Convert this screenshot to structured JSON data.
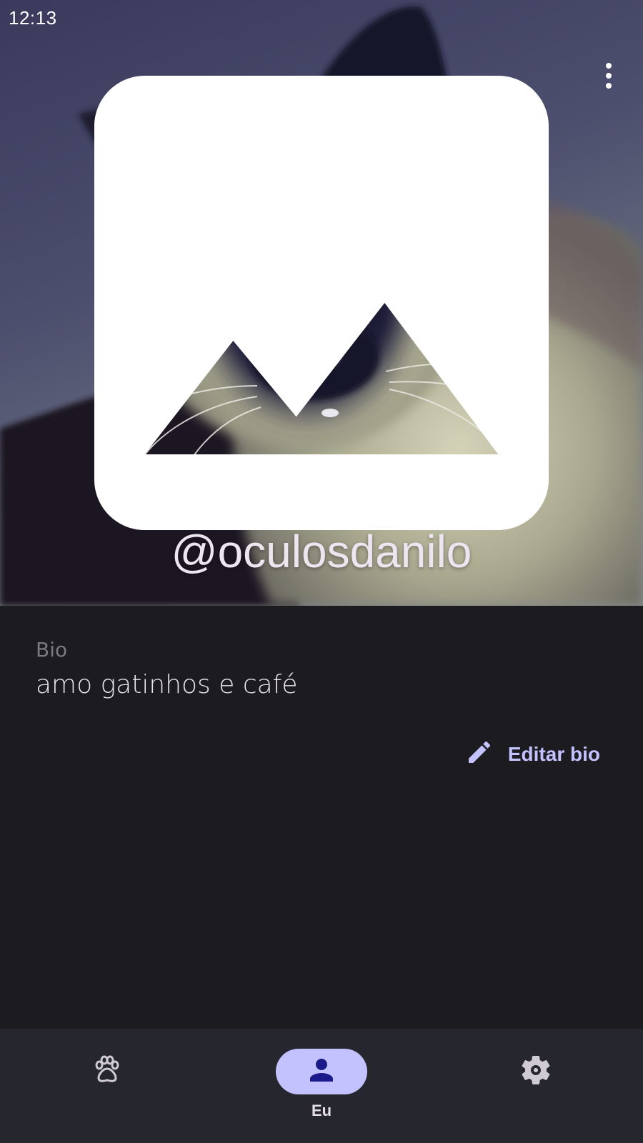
{
  "status_bar": {
    "time": "12:13",
    "notification_icon": "image-icon"
  },
  "profile": {
    "photo_subject": "siamese cat",
    "username": "@oculosdanilo",
    "menu_icon": "more-vert-icon"
  },
  "bio": {
    "label": "Bio",
    "text": "amo gatinhos e café",
    "edit_label": "Editar bio",
    "edit_icon": "pencil-icon"
  },
  "bottom_nav": {
    "items": [
      {
        "icon": "paw-icon",
        "label": "",
        "active": false
      },
      {
        "icon": "person-icon",
        "label": "Eu",
        "active": true
      },
      {
        "icon": "gear-icon",
        "label": "",
        "active": false
      }
    ]
  },
  "colors": {
    "background": "#1c1b20",
    "nav_background": "#26262f",
    "accent": "#c3c2ff",
    "accent_dark": "#1b1a8a"
  }
}
